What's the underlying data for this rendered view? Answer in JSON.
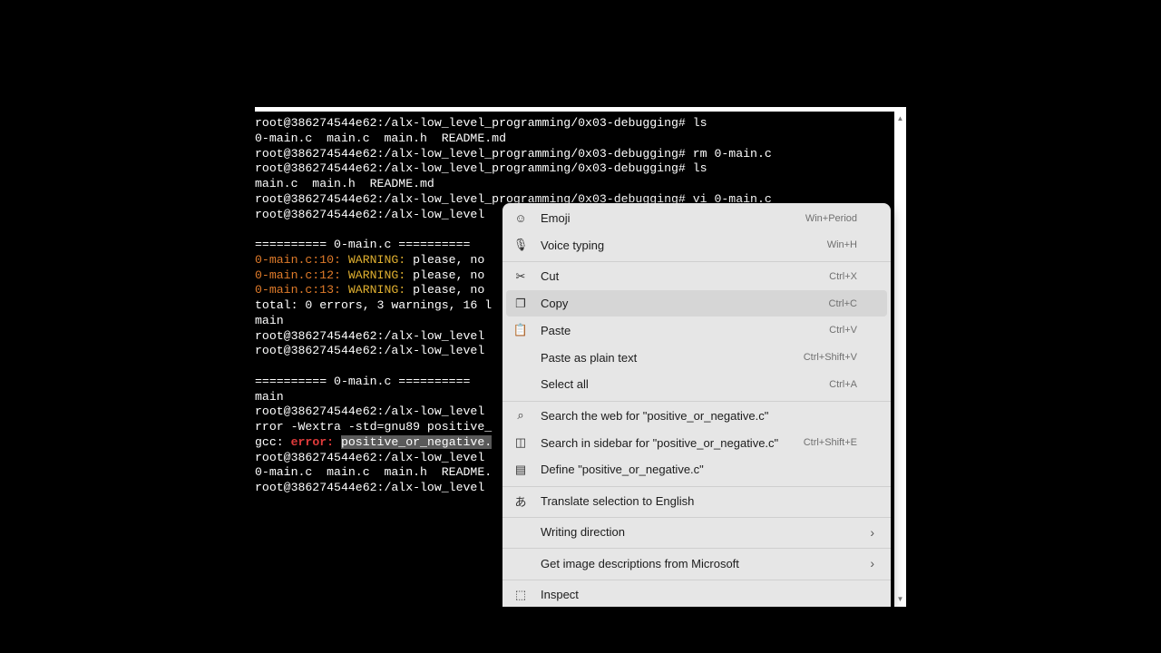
{
  "terminal": {
    "lines": [
      [
        {
          "t": "root@386274544e62:/alx-low_level_programming/0x03-debugging# ls"
        }
      ],
      [
        {
          "t": "0-main.c  main.c  main.h  README.md"
        }
      ],
      [
        {
          "t": "root@386274544e62:/alx-low_level_programming/0x03-debugging# rm 0-main.c"
        }
      ],
      [
        {
          "t": "root@386274544e62:/alx-low_level_programming/0x03-debugging# ls"
        }
      ],
      [
        {
          "t": "main.c  main.h  README.md"
        }
      ],
      [
        {
          "t": "root@386274544e62:/alx-low_level_programming/0x03-debugging# vi 0-main.c"
        }
      ],
      [
        {
          "t": "root@386274544e62:/alx-low_level"
        }
      ],
      [
        {
          "t": ""
        }
      ],
      [
        {
          "t": "========== 0-main.c =========="
        }
      ],
      [
        {
          "t": "0-main.c:10:",
          "c": "warn-file"
        },
        {
          "t": " "
        },
        {
          "t": "WARNING:",
          "c": "warn-tag"
        },
        {
          "t": " please, no"
        }
      ],
      [
        {
          "t": "0-main.c:12:",
          "c": "warn-file"
        },
        {
          "t": " "
        },
        {
          "t": "WARNING:",
          "c": "warn-tag"
        },
        {
          "t": " please, no"
        }
      ],
      [
        {
          "t": "0-main.c:13:",
          "c": "warn-file"
        },
        {
          "t": " "
        },
        {
          "t": "WARNING:",
          "c": "warn-tag"
        },
        {
          "t": " please, no"
        }
      ],
      [
        {
          "t": "total: 0 errors, 3 warnings, 16 l"
        }
      ],
      [
        {
          "t": "main"
        }
      ],
      [
        {
          "t": "root@386274544e62:/alx-low_level"
        }
      ],
      [
        {
          "t": "root@386274544e62:/alx-low_level"
        }
      ],
      [
        {
          "t": ""
        }
      ],
      [
        {
          "t": "========== 0-main.c =========="
        }
      ],
      [
        {
          "t": "main"
        }
      ],
      [
        {
          "t": "root@386274544e62:/alx-low_level"
        }
      ],
      [
        {
          "t": "rror -Wextra -std=gnu89 positive_"
        }
      ],
      [
        {
          "t": "gcc:"
        },
        {
          "t": " "
        },
        {
          "t": "error:",
          "c": "err-tag"
        },
        {
          "t": " "
        },
        {
          "t": "positive_or_negative.",
          "c": "sel"
        }
      ],
      [
        {
          "t": "root@386274544e62:/alx-low_level"
        }
      ],
      [
        {
          "t": "0-main.c  main.c  main.h  README."
        }
      ],
      [
        {
          "t": "root@386274544e62:/alx-low_level"
        }
      ]
    ]
  },
  "scrollbar": {
    "up_icon": "▲",
    "down_icon": "▼"
  },
  "context_menu": {
    "items": [
      {
        "name": "menu-item-emoji",
        "icon_name": "emoji-icon",
        "icon": "☺",
        "label": "Emoji",
        "shortcut": "Win+Period"
      },
      {
        "name": "menu-item-voice-typing",
        "icon_name": "microphone-icon",
        "icon": "🎙",
        "label": "Voice typing",
        "shortcut": "Win+H"
      },
      {
        "sep": true
      },
      {
        "name": "menu-item-cut",
        "icon_name": "scissors-icon",
        "icon": "✂",
        "label": "Cut",
        "shortcut": "Ctrl+X"
      },
      {
        "name": "menu-item-copy",
        "icon_name": "copy-icon",
        "icon": "❐",
        "label": "Copy",
        "shortcut": "Ctrl+C",
        "hover": true
      },
      {
        "name": "menu-item-paste",
        "icon_name": "clipboard-icon",
        "icon": "📋",
        "label": "Paste",
        "shortcut": "Ctrl+V"
      },
      {
        "name": "menu-item-paste-plain",
        "icon_name": "",
        "icon": "",
        "label": "Paste as plain text",
        "shortcut": "Ctrl+Shift+V"
      },
      {
        "name": "menu-item-select-all",
        "icon_name": "",
        "icon": "",
        "label": "Select all",
        "shortcut": "Ctrl+A"
      },
      {
        "sep": true
      },
      {
        "name": "menu-item-search-web",
        "icon_name": "search-icon",
        "icon": "⌕",
        "label": "Search the web for \"positive_or_negative.c\"",
        "shortcut": ""
      },
      {
        "name": "menu-item-search-sidebar",
        "icon_name": "sidebar-search-icon",
        "icon": "◫",
        "label": "Search in sidebar for \"positive_or_negative.c\"",
        "shortcut": "Ctrl+Shift+E"
      },
      {
        "name": "menu-item-define",
        "icon_name": "book-icon",
        "icon": "▤",
        "label": "Define \"positive_or_negative.c\"",
        "shortcut": ""
      },
      {
        "sep": true
      },
      {
        "name": "menu-item-translate",
        "icon_name": "translate-icon",
        "icon": "あ",
        "label": "Translate selection to English",
        "shortcut": ""
      },
      {
        "sep": true
      },
      {
        "name": "menu-item-writing-direction",
        "icon_name": "",
        "icon": "",
        "label": "Writing direction",
        "shortcut": "",
        "submenu": true
      },
      {
        "sep": true
      },
      {
        "name": "menu-item-image-descriptions",
        "icon_name": "",
        "icon": "",
        "label": "Get image descriptions from Microsoft",
        "shortcut": "",
        "submenu": true
      },
      {
        "sep": true
      },
      {
        "name": "menu-item-inspect",
        "icon_name": "inspect-icon",
        "icon": "⬚",
        "label": "Inspect",
        "shortcut": ""
      }
    ],
    "submenu_arrow": "›"
  }
}
